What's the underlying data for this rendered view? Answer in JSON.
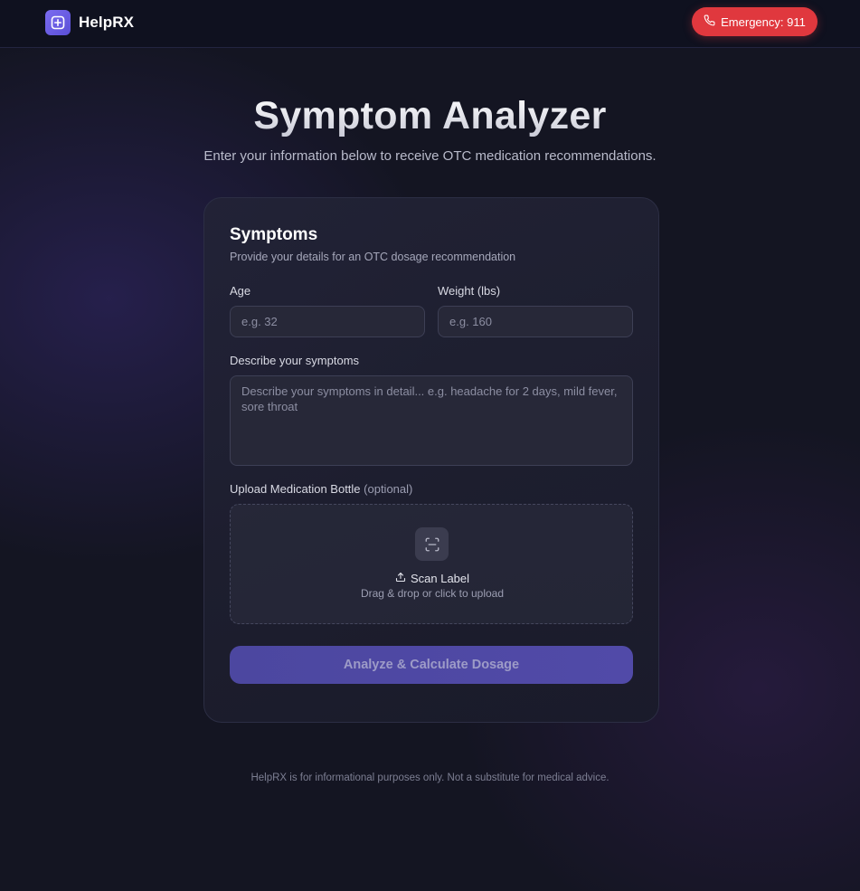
{
  "header": {
    "brand_name": "HelpRX",
    "emergency_label": "Emergency: 911"
  },
  "hero": {
    "title": "Symptom Analyzer",
    "subtitle": "Enter your information below to receive OTC medication recommendations."
  },
  "form": {
    "title": "Symptoms",
    "subtitle": "Provide your details for an OTC dosage recommendation",
    "age_label": "Age",
    "age_placeholder": "e.g. 32",
    "age_value": "",
    "weight_label": "Weight (lbs)",
    "weight_placeholder": "e.g. 160",
    "weight_value": "",
    "symptoms_label": "Describe your symptoms",
    "symptoms_placeholder": "Describe your symptoms in detail... e.g. headache for 2 days, mild fever, sore throat",
    "symptoms_value": "",
    "upload_label": "Upload Medication Bottle",
    "upload_optional": "(optional)",
    "scan_label": "Scan Label",
    "drag_hint": "Drag & drop or click to upload",
    "submit_label": "Analyze & Calculate Dosage"
  },
  "footer": {
    "disclaimer": "HelpRX is for informational purposes only. Not a substitute for medical advice."
  },
  "icons": {
    "logo": "plus-square-icon",
    "emergency": "phone-icon",
    "scan": "scan-icon",
    "upload": "upload-icon"
  },
  "colors": {
    "accent": "#6c5ce7",
    "emergency": "#e0383e",
    "background": "#141522",
    "card": "#1f2031"
  }
}
